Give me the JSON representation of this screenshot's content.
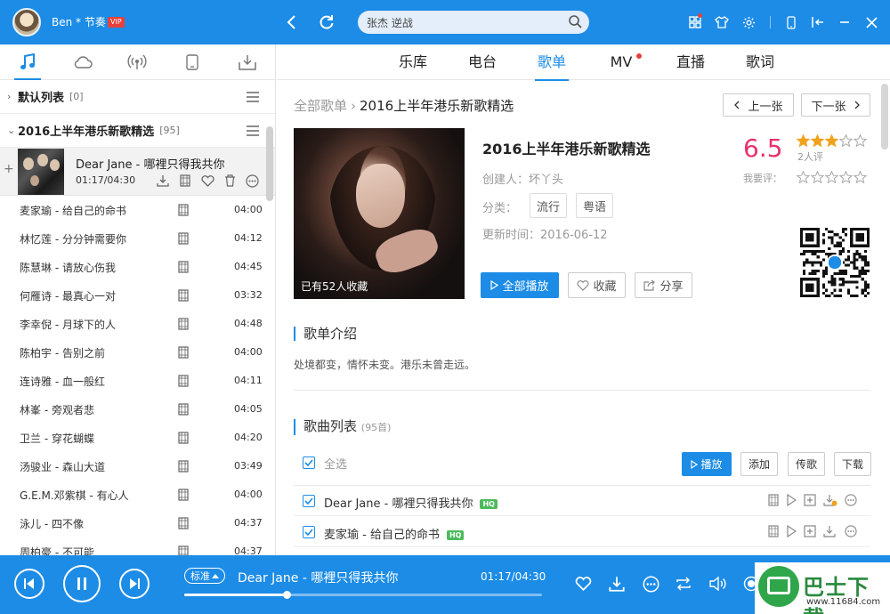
{
  "topbar": {
    "user_name": "Ben * 节奏",
    "vip_badge": "VIP",
    "search_value": "张杰 逆战"
  },
  "left": {
    "groups": [
      {
        "label": "默认列表",
        "count": "[0]",
        "arrow": "›"
      },
      {
        "label": "2016上半年港乐新歌精选",
        "count": "[95]",
        "arrow": "⌄"
      }
    ],
    "now_playing": {
      "title": "Dear Jane - 哪裡只得我共你",
      "time": "01:17/04:30"
    },
    "songs": [
      {
        "title": "麦家瑜 - 给自己的命书",
        "duration": "04:00"
      },
      {
        "title": "林忆莲 - 分分钟需要你",
        "duration": "04:12"
      },
      {
        "title": "陈慧琳 - 请放心伤我",
        "duration": "04:45"
      },
      {
        "title": "何雁诗 - 最真心一对",
        "duration": "03:32"
      },
      {
        "title": "李幸倪 - 月球下的人",
        "duration": "04:48"
      },
      {
        "title": "陈柏宇 - 告别之前",
        "duration": "04:00"
      },
      {
        "title": "连诗雅 - 血一般红",
        "duration": "04:11"
      },
      {
        "title": "林峯 - 旁观者悲",
        "duration": "04:05"
      },
      {
        "title": "卫兰 - 穿花蝴蝶",
        "duration": "04:20"
      },
      {
        "title": "汤骏业 - 森山大道",
        "duration": "03:49"
      },
      {
        "title": "G.E.M.邓紫棋 - 有心人",
        "duration": "04:00"
      },
      {
        "title": "泳儿 - 四不像",
        "duration": "04:37"
      },
      {
        "title": "周柏豪 - 不可能",
        "duration": "04:37"
      }
    ]
  },
  "right": {
    "tabs": [
      "乐库",
      "电台",
      "歌单",
      "MV",
      "直播",
      "歌词"
    ],
    "active_tab": "歌单",
    "breadcrumb": {
      "parent": "全部歌单",
      "sep": "›",
      "current": "2016上半年港乐新歌精选"
    },
    "prev_label": "上一张",
    "next_label": "下一张",
    "cover_caption": "已有52人收藏",
    "playlist_title": "2016上半年港乐新歌精选",
    "creator_label": "创建人：",
    "creator": "坏丫头",
    "category_label": "分类：",
    "tags": [
      "流行",
      "粤语"
    ],
    "updated_label": "更新时间：",
    "updated": "2016-06-12",
    "play_all": "全部播放",
    "collect": "收藏",
    "share": "分享",
    "score": "6.5",
    "rating_stars": 3,
    "raters": "2人评",
    "my_rate_label": "我要评：",
    "intro_title": "歌单介绍",
    "intro_text": "处境都变，情怀未变。港乐未曾走远。",
    "list_title": "歌曲列表",
    "list_count": "(95首)",
    "select_all": "全选",
    "list_buttons": [
      "播放",
      "添加",
      "传歌",
      "下载"
    ],
    "list_songs": [
      {
        "title": "Dear Jane - 哪裡只得我共你",
        "hq": "HQ"
      },
      {
        "title": "麦家瑜 - 给自己的命书",
        "hq": "HQ"
      }
    ]
  },
  "player": {
    "quality": "标准",
    "title": "Dear Jane - 哪裡只得我共你",
    "time": "01:17/04:30",
    "progress": 0.285
  },
  "watermark": {
    "brand": "巴士下载",
    "url": "www.11684.com"
  },
  "colors": {
    "accent": "#1c8ce6",
    "score": "#e8316b",
    "star": "#f0a21b",
    "hq": "#4cbb5b",
    "badge": "#e5403b"
  }
}
